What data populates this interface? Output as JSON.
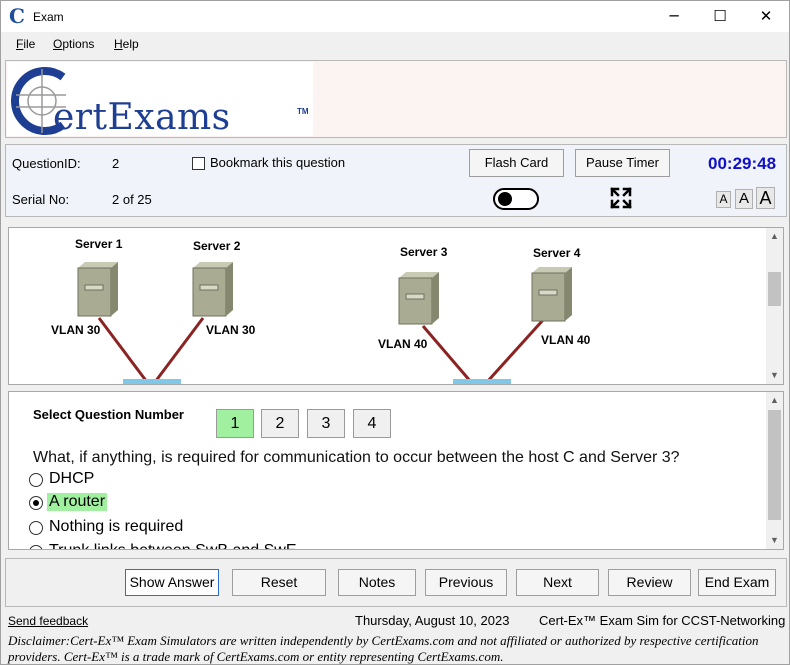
{
  "window": {
    "title": "Exam",
    "app_icon": "C",
    "minimize": "─",
    "maximize": "☐",
    "close": "✕"
  },
  "menu": [
    {
      "label": "File",
      "key": "F",
      "rest": "ile"
    },
    {
      "label": "Options",
      "key": "O",
      "rest": "ptions"
    },
    {
      "label": "Help",
      "key": "H",
      "rest": "elp"
    }
  ],
  "logo": {
    "text": "ertExams",
    "tm": "TM"
  },
  "info": {
    "question_id_label": "QuestionID:",
    "question_id": "2",
    "bookmark_label": "Bookmark this question",
    "serial_label": "Serial No:",
    "serial": "2 of 25",
    "flash_card": "Flash Card",
    "pause_timer": "Pause Timer",
    "timer": "00:29:48",
    "font_sizes": [
      "A",
      "A",
      "A"
    ]
  },
  "exhibit": {
    "servers": [
      {
        "name": "Server 1",
        "vlan": "VLAN 30"
      },
      {
        "name": "Server 2",
        "vlan": "VLAN 30"
      },
      {
        "name": "Server 3",
        "vlan": "VLAN 40"
      },
      {
        "name": "Server 4",
        "vlan": "VLAN 40"
      }
    ]
  },
  "question": {
    "select_label": "Select Question Number",
    "numbers": [
      "1",
      "2",
      "3",
      "4"
    ],
    "active_number": "1",
    "text": "What, if anything, is required for communication to occur between the host C and Server 3?",
    "options": [
      {
        "label": "DHCP",
        "selected": false
      },
      {
        "label": "A router",
        "selected": true
      },
      {
        "label": "Nothing is required",
        "selected": false
      },
      {
        "label": "Trunk links between SwB and SwE",
        "selected": false
      }
    ]
  },
  "actions": [
    "Show Answer",
    "Reset",
    "Notes",
    "Previous",
    "Next",
    "Review",
    "End Exam"
  ],
  "footer": {
    "feedback": "Send feedback",
    "date": "Thursday, August 10, 2023",
    "product": "Cert-Ex™ Exam Sim for CCST-Networking",
    "disclaimer": "Disclaimer:Cert-Ex™ Exam Simulators are written independently by CertExams.com and not affiliated or authorized by respective certification providers. Cert-Ex™ is a trade mark of CertExams.com or entity representing CertExams.com."
  },
  "colors": {
    "timer": "#1010c8",
    "logo": "#1e3e93",
    "selected": "#a0f0a0",
    "cable": "#8b2323"
  }
}
